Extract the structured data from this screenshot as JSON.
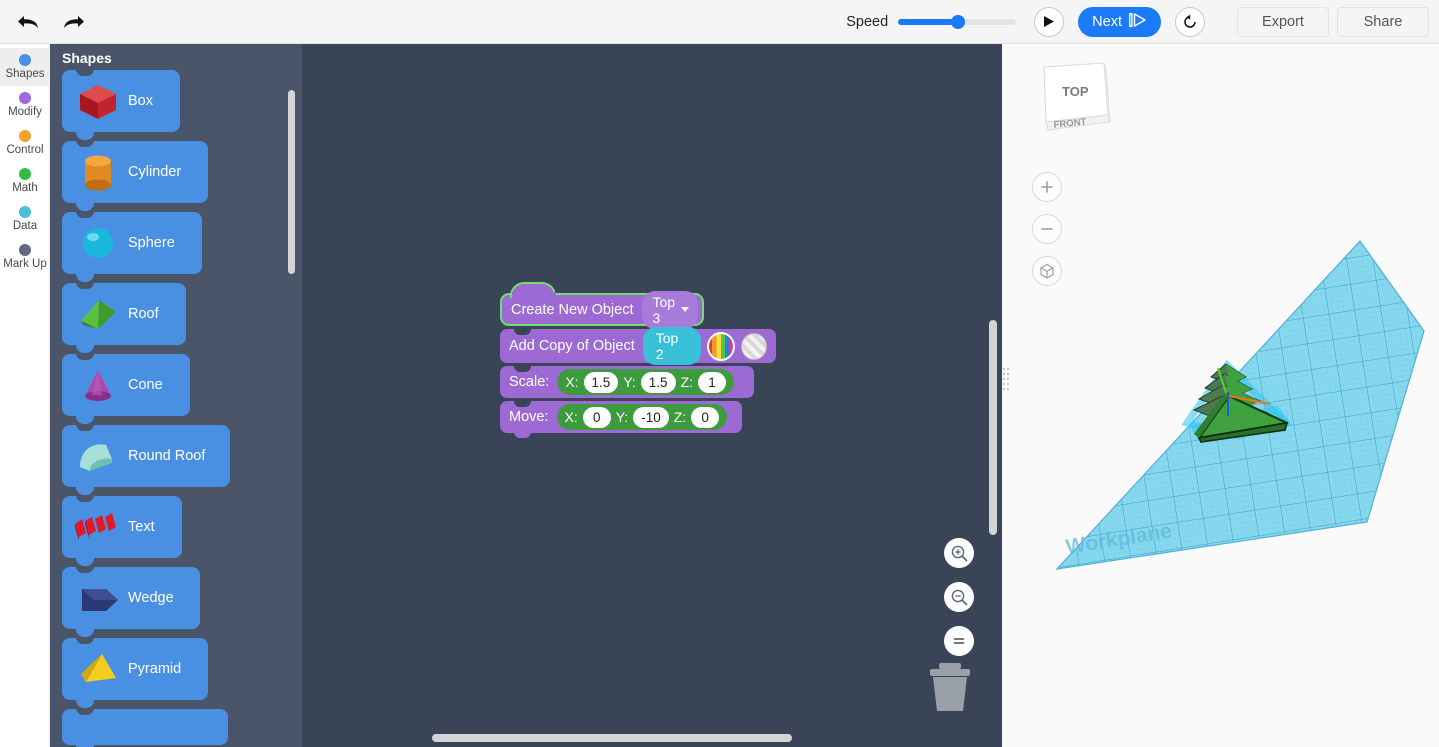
{
  "toolbar": {
    "undo_icon": "undo-arrow-icon",
    "redo_icon": "redo-arrow-icon",
    "speed_label": "Speed",
    "speed_value": 50,
    "play_label": "play-icon",
    "next_label": "Next",
    "restart_label": "restart-icon",
    "export_label": "Export",
    "share_label": "Share"
  },
  "rail": {
    "items": [
      {
        "label": "Shapes",
        "color": "#4a90e2",
        "active": true
      },
      {
        "label": "Modify",
        "color": "#9b6ae0",
        "active": false
      },
      {
        "label": "Control",
        "color": "#f2a32a",
        "active": false
      },
      {
        "label": "Math",
        "color": "#33bb44",
        "active": false
      },
      {
        "label": "Data",
        "color": "#4ebdd8",
        "active": false
      },
      {
        "label": "Mark Up",
        "color": "#5f6b7c",
        "active": false
      }
    ]
  },
  "drawer": {
    "title": "Shapes",
    "blocks": [
      {
        "label": "Box",
        "icon": "box-icon",
        "color": "#c0242c"
      },
      {
        "label": "Cylinder",
        "icon": "cylinder-icon",
        "color": "#e08a22"
      },
      {
        "label": "Sphere",
        "icon": "sphere-icon",
        "color": "#19b8d8"
      },
      {
        "label": "Roof",
        "icon": "roof-icon",
        "color": "#46a832"
      },
      {
        "label": "Cone",
        "icon": "cone-icon",
        "color": "#9c3f9c"
      },
      {
        "label": "Round Roof",
        "icon": "round-roof-icon",
        "color": "#8fd4cc"
      },
      {
        "label": "Text",
        "icon": "text-icon",
        "color": "#e01a28"
      },
      {
        "label": "Wedge",
        "icon": "wedge-icon",
        "color": "#2b3a75"
      },
      {
        "label": "Pyramid",
        "icon": "pyramid-icon",
        "color": "#f2cf1f"
      }
    ]
  },
  "code": {
    "blocks": [
      {
        "type": "create-new-object",
        "label": "Create New Object",
        "object_name": "Top 3",
        "highlighted": true
      },
      {
        "type": "add-copy-of-object",
        "label": "Add Copy of Object",
        "object_name": "Top 2",
        "fill_swatch": "rainbow-color-swatch",
        "hole_swatch": "hole-swatch",
        "selected_swatch": "rainbow-color-swatch"
      },
      {
        "type": "scale",
        "label": "Scale:",
        "axes": [
          {
            "axis": "X:",
            "value": "1.5"
          },
          {
            "axis": "Y:",
            "value": "1.5"
          },
          {
            "axis": "Z:",
            "value": "1"
          }
        ]
      },
      {
        "type": "move",
        "label": "Move:",
        "axes": [
          {
            "axis": "X:",
            "value": "0"
          },
          {
            "axis": "Y:",
            "value": "-10"
          },
          {
            "axis": "Z:",
            "value": "0"
          }
        ]
      }
    ],
    "controls": [
      {
        "name": "zoom-in-icon"
      },
      {
        "name": "zoom-out-icon"
      },
      {
        "name": "fit-view-icon"
      },
      {
        "name": "trash-icon"
      }
    ]
  },
  "viewport": {
    "viewcube_top": "TOP",
    "viewcube_front": "FRONT",
    "zoom_in": "zoom-in-icon",
    "zoom_out": "zoom-out-icon",
    "fit_all": "fit-all-icon",
    "workplane_label": "Workplane",
    "model": {
      "name": "stacked-green-pyramid",
      "color": "#3fa13f",
      "selected": true
    }
  },
  "colors": {
    "accent": "#1a7af8",
    "canvas_bg": "#394457",
    "drawer_bg": "#4a5569",
    "shape_block": "#4a90e2",
    "code_block_purple": "#9d6ad4",
    "code_block_green": "#3c9b3c",
    "highlight_green": "#6ee06e",
    "workplane": "#7fd4ec"
  }
}
